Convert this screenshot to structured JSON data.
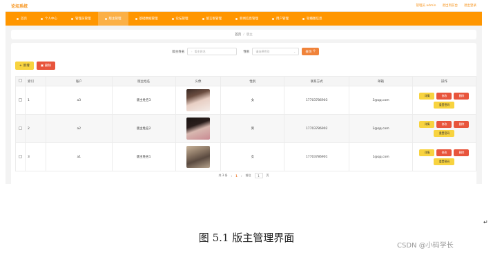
{
  "app": {
    "title": "论坛系统",
    "user_info": "管理员 admin",
    "back_link": "退出到前台",
    "logout": "退出登录"
  },
  "nav": {
    "items": [
      {
        "label": "首页",
        "active": false
      },
      {
        "label": "个人中心",
        "active": false
      },
      {
        "label": "管理员管理",
        "active": false
      },
      {
        "label": "版主管理",
        "active": true
      },
      {
        "label": "基础数据管理",
        "active": false
      },
      {
        "label": "论坛管理",
        "active": false
      },
      {
        "label": "留言板管理",
        "active": false
      },
      {
        "label": "新闻信息管理",
        "active": false
      },
      {
        "label": "用户管理",
        "active": false
      },
      {
        "label": "轮播图信息",
        "active": false
      }
    ]
  },
  "breadcrumb": {
    "home": "首页",
    "separator": "/",
    "current": "版主"
  },
  "search": {
    "name_label": "版主姓名",
    "name_placeholder": "版主姓名",
    "gender_label": "性别",
    "gender_placeholder": "请选择性别",
    "search_button": "查询"
  },
  "actions": {
    "add_button": "新增",
    "delete_button": "删除"
  },
  "table": {
    "columns": [
      "索引",
      "账户",
      "版主姓名",
      "头像",
      "性别",
      "联系方式",
      "邮箱",
      "操作"
    ],
    "rows": [
      {
        "index": "1",
        "account": "a3",
        "name": "版主姓名3",
        "gender": "女",
        "phone": "17703786903",
        "email": "3@qq.com"
      },
      {
        "index": "2",
        "account": "a2",
        "name": "版主姓名2",
        "gender": "男",
        "phone": "17703786902",
        "email": "2@qq.com"
      },
      {
        "index": "3",
        "account": "a1",
        "name": "版主姓名1",
        "gender": "女",
        "phone": "17703786901",
        "email": "1@qq.com"
      }
    ],
    "ops": {
      "detail": "详情",
      "edit": "修改",
      "delete": "删除",
      "reset": "重置密码"
    }
  },
  "pagination": {
    "total": "共 3 条",
    "prev": "‹",
    "page": "1",
    "next": "›",
    "goto_label": "前往",
    "goto_value": "1",
    "page_suffix": "页"
  },
  "caption": "图 5.1 版主管理界面",
  "return_mark": "↵",
  "watermark": "CSDN @小码学长",
  "colors": {
    "accent": "#ff9600",
    "brand": "#f7931a",
    "danger": "#e8553c",
    "warning": "#f8d33f"
  }
}
